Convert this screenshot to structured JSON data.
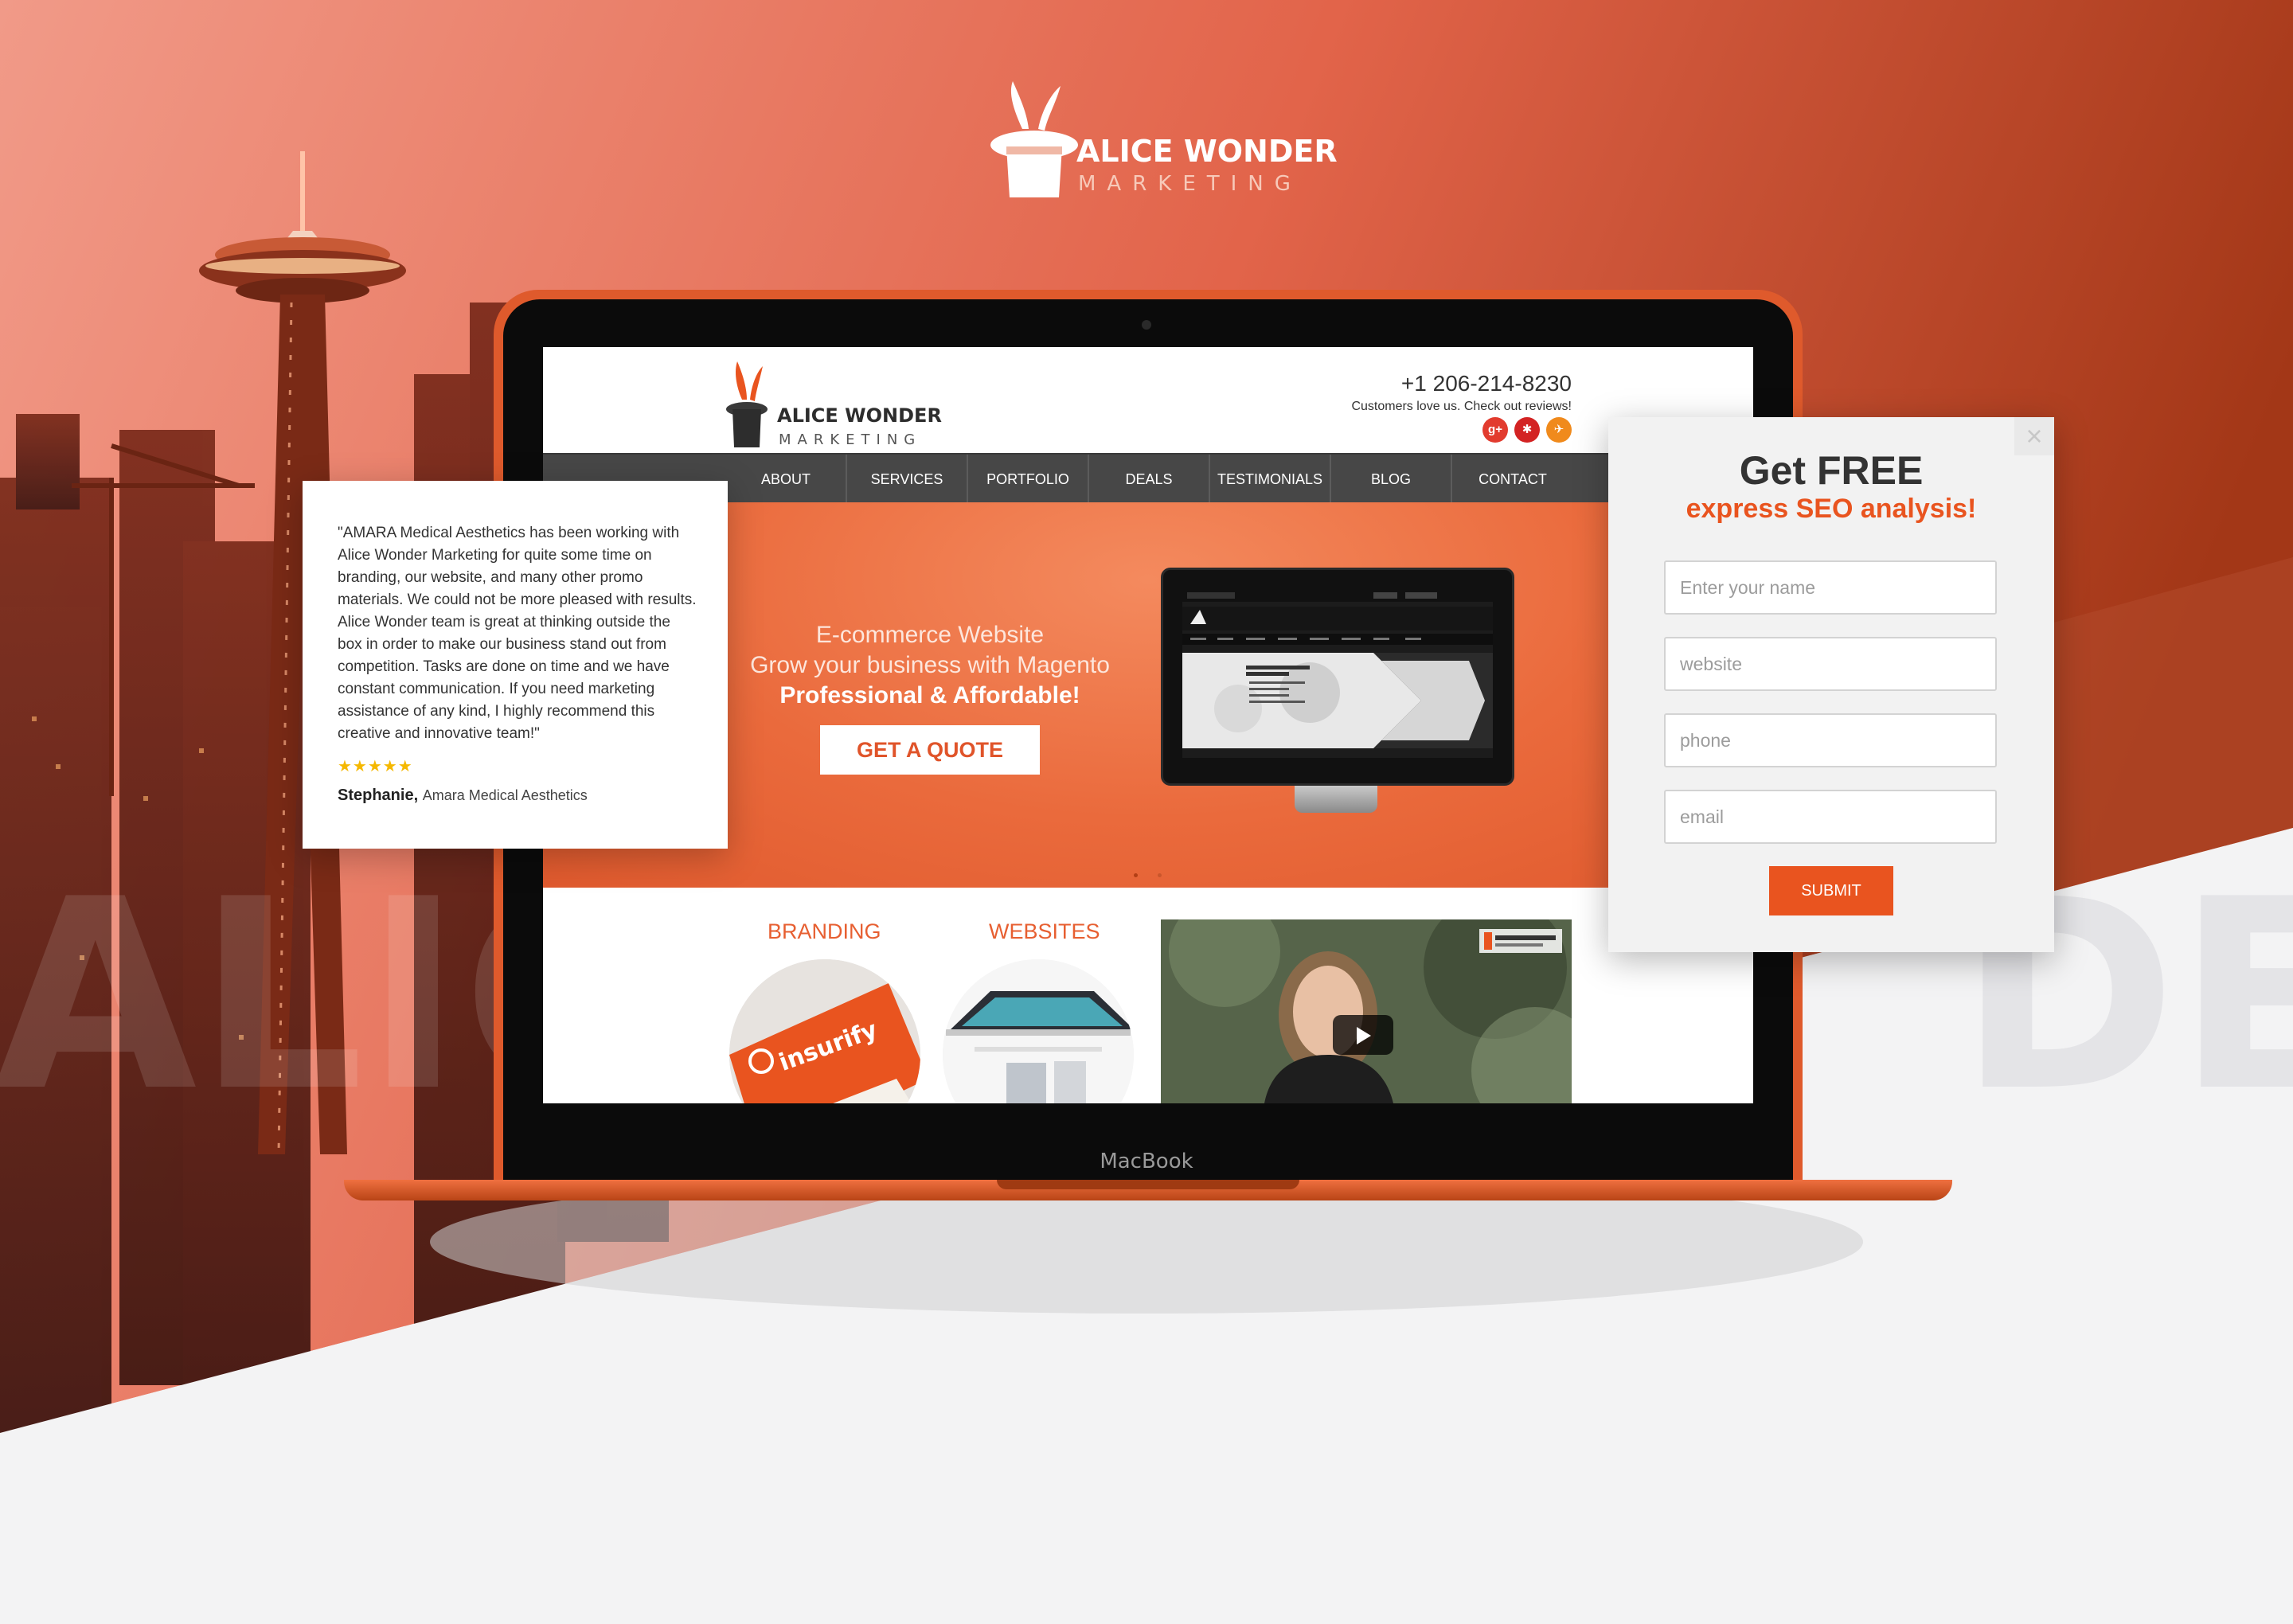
{
  "brand": {
    "name": "ALICE WONDER",
    "sub": "MARKETING"
  },
  "laptop": {
    "label": "MacBook"
  },
  "site": {
    "logo": {
      "name": "ALICE WONDER",
      "sub": "MARKETING"
    },
    "phone": "+1 206-214-8230",
    "reviews": "Customers love us. Check out reviews!",
    "social": [
      {
        "icon": "google-plus-icon",
        "glyph": "g+",
        "color": "#e23b2e"
      },
      {
        "icon": "yelp-icon",
        "glyph": "✱",
        "color": "#d32323"
      },
      {
        "icon": "pin-icon",
        "glyph": "✈",
        "color": "#f08a1c"
      }
    ],
    "nav": [
      "ABOUT",
      "SERVICES",
      "PORTFOLIO",
      "DEALS",
      "TESTIMONIALS",
      "BLOG",
      "CONTACT"
    ],
    "hero": {
      "line1": "E-commerce Website",
      "line2": "Grow your business with Magento",
      "line3": "Professional & Affordable!",
      "cta": "GET A QUOTE"
    },
    "categories": [
      "BRANDING",
      "WEBSITES"
    ],
    "branding_card_text": "insurify"
  },
  "testimonial": {
    "text": "\"AMARA Medical Aesthetics has been working with Alice Wonder Marketing for quite some time on branding, our website, and many other promo materials. We could not be more pleased with results. Alice Wonder team is great at thinking outside the box in order to make our business stand out from competition. Tasks are done on time and we have constant communication. If you need marketing assistance of any kind, I highly recommend this creative and innovative team!\"",
    "stars": "★★★★★",
    "rating": 5,
    "author": "Stephanie,",
    "company": "Amara Medical Aesthetics"
  },
  "seo": {
    "close": "×",
    "title": "Get FREE",
    "subtitle": "express SEO analysis!",
    "fields": [
      {
        "name": "name-field",
        "placeholder": "Enter your name"
      },
      {
        "name": "website-field",
        "placeholder": "website"
      },
      {
        "name": "phone-field",
        "placeholder": "phone"
      },
      {
        "name": "email-field",
        "placeholder": "email"
      }
    ],
    "submit": "SUBMIT"
  },
  "ghost": {
    "left": "ALIC",
    "right": "DER"
  },
  "colors": {
    "accent": "#e9541f",
    "nav": "#474747",
    "hero": "#ea6a3c"
  }
}
